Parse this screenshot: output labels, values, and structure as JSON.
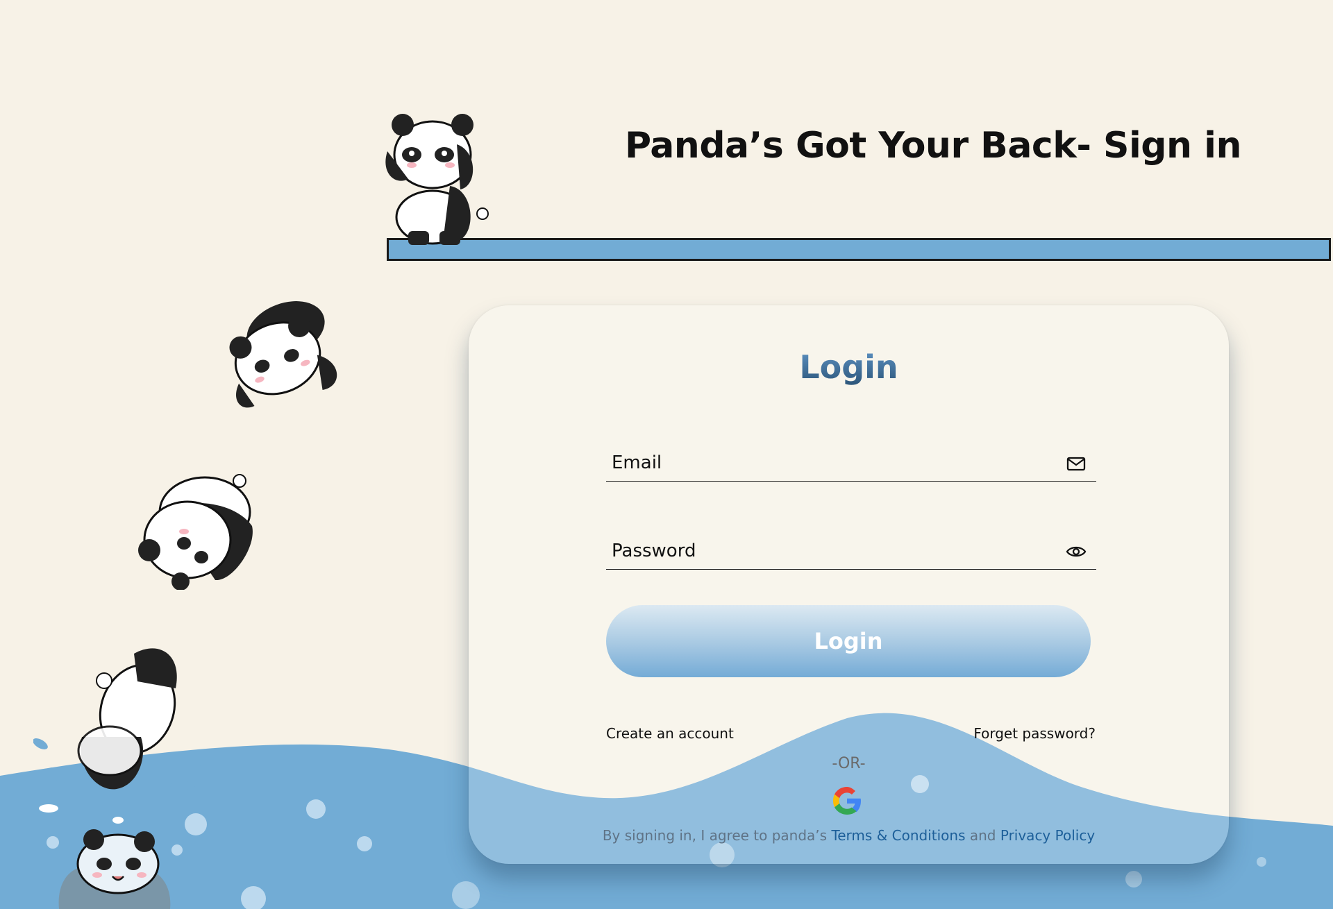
{
  "header": {
    "title": "Panda’s Got Your Back- Sign in"
  },
  "login_card": {
    "heading": "Login",
    "email": {
      "placeholder": "Email",
      "value": "",
      "icon": "mail-icon"
    },
    "password": {
      "placeholder": "Password",
      "value": "",
      "icon": "eye-icon"
    },
    "submit_label": "Login",
    "create_account": "Create an account",
    "forgot_password": "Forget password?",
    "or_separator": "-OR-",
    "google_icon": "google-icon",
    "terms": {
      "prefix": "By signing in, I agree to panda’s ",
      "terms_link": "Terms & Conditions",
      "middle": " and ",
      "privacy_link": "Privacy Policy"
    }
  },
  "colors": {
    "background": "#f7f2e7",
    "water": "#72acd5",
    "accent_dark": "#1d5f99",
    "title_gradient": [
      "#5e93c4",
      "#2c5579"
    ]
  }
}
